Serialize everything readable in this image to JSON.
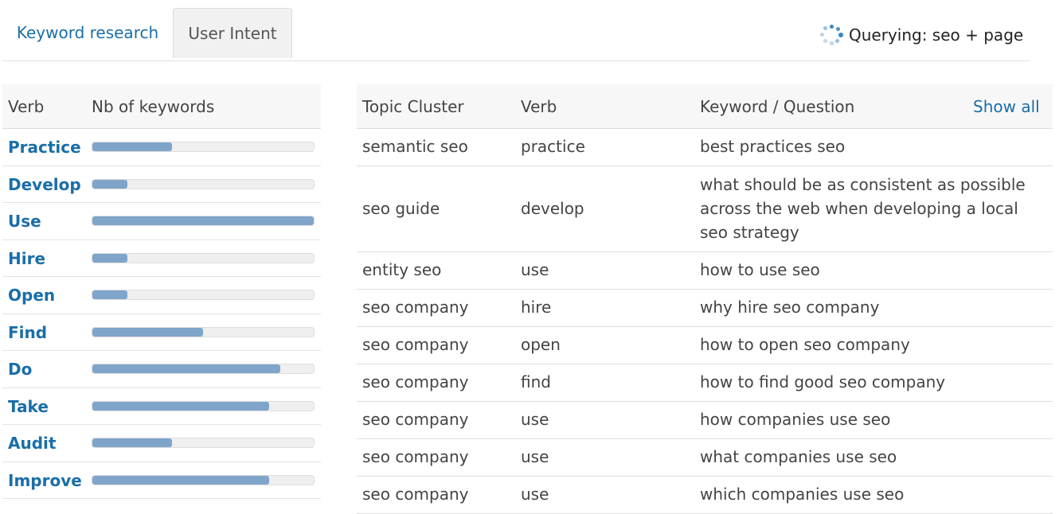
{
  "tabs": {
    "keyword_research": "Keyword research",
    "user_intent": "User Intent"
  },
  "status": {
    "text": "Querying: seo + page"
  },
  "left_table": {
    "headers": {
      "verb": "Verb",
      "nb": "Nb of keywords"
    },
    "rows": [
      {
        "verb": "Practice",
        "share": 0.36
      },
      {
        "verb": "Develop",
        "share": 0.16
      },
      {
        "verb": "Use",
        "share": 1.0
      },
      {
        "verb": "Hire",
        "share": 0.16
      },
      {
        "verb": "Open",
        "share": 0.16
      },
      {
        "verb": "Find",
        "share": 0.5
      },
      {
        "verb": "Do",
        "share": 0.85
      },
      {
        "verb": "Take",
        "share": 0.8
      },
      {
        "verb": "Audit",
        "share": 0.36
      },
      {
        "verb": "Improve",
        "share": 0.8
      }
    ]
  },
  "right_table": {
    "headers": {
      "topic": "Topic Cluster",
      "verb": "Verb",
      "keyword": "Keyword / Question",
      "show_all": "Show all"
    },
    "rows": [
      {
        "topic": "semantic seo",
        "verb": "practice",
        "keyword": "best practices seo"
      },
      {
        "topic": "seo guide",
        "verb": "develop",
        "keyword": "what should be as consistent as possible across the web when developing a local seo strategy"
      },
      {
        "topic": "entity seo",
        "verb": "use",
        "keyword": "how to use seo"
      },
      {
        "topic": "seo company",
        "verb": "hire",
        "keyword": "why hire seo company"
      },
      {
        "topic": "seo company",
        "verb": "open",
        "keyword": "how to open seo company"
      },
      {
        "topic": "seo company",
        "verb": "find",
        "keyword": "how to find good seo company"
      },
      {
        "topic": "seo company",
        "verb": "use",
        "keyword": "how companies use seo"
      },
      {
        "topic": "seo company",
        "verb": "use",
        "keyword": "what companies use seo"
      },
      {
        "topic": "seo company",
        "verb": "use",
        "keyword": "which companies use seo"
      }
    ]
  },
  "colors": {
    "link": "#1a6ea8",
    "bar_fill": "#7fa5ca",
    "bar_track": "#efefef"
  }
}
